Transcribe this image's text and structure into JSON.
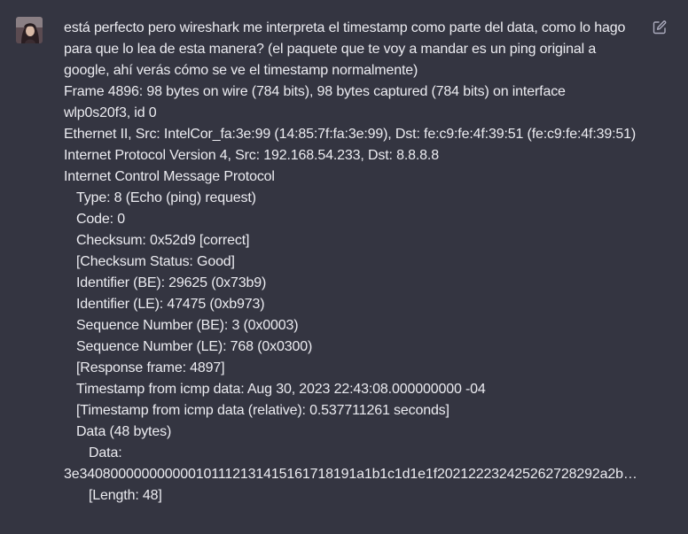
{
  "message": {
    "lines": [
      "está perfecto pero wireshark me interpreta el timestamp como parte del data, como lo hago",
      "para que lo lea de esta manera? (el paquete que te voy a mandar es un ping original a",
      "google, ahí verás cómo se ve el timestamp normalmente)",
      "Frame 4896: 98 bytes on wire (784 bits), 98 bytes captured (784 bits) on interface",
      "wlp0s20f3, id 0",
      "Ethernet II, Src: IntelCor_fa:3e:99 (14:85:7f:fa:3e:99), Dst: fe:c9:fe:4f:39:51 (fe:c9:fe:4f:39:51)",
      "Internet Protocol Version 4, Src: 192.168.54.233, Dst: 8.8.8.8",
      "Internet Control Message Protocol"
    ],
    "icmp_fields": [
      "Type: 8 (Echo (ping) request)",
      "Code: 0",
      "Checksum: 0x52d9 [correct]",
      "[Checksum Status: Good]",
      "Identifier (BE): 29625 (0x73b9)",
      "Identifier (LE): 47475 (0xb973)",
      "Sequence Number (BE): 3 (0x0003)",
      "Sequence Number (LE): 768 (0x0300)",
      "[Response frame: 4897]",
      "Timestamp from icmp data: Aug 30, 2023 22:43:08.000000000 -04",
      "[Timestamp from icmp data (relative): 0.537711261 seconds]",
      "Data (48 bytes)"
    ],
    "data_label": "Data:",
    "data_hex": "3e340800000000000101112131415161718191a1b1c1d1e1f202122232425262728292a2b…",
    "length_line": "[Length: 48]"
  },
  "icons": {
    "avatar": "user-avatar",
    "edit": "edit-icon"
  }
}
